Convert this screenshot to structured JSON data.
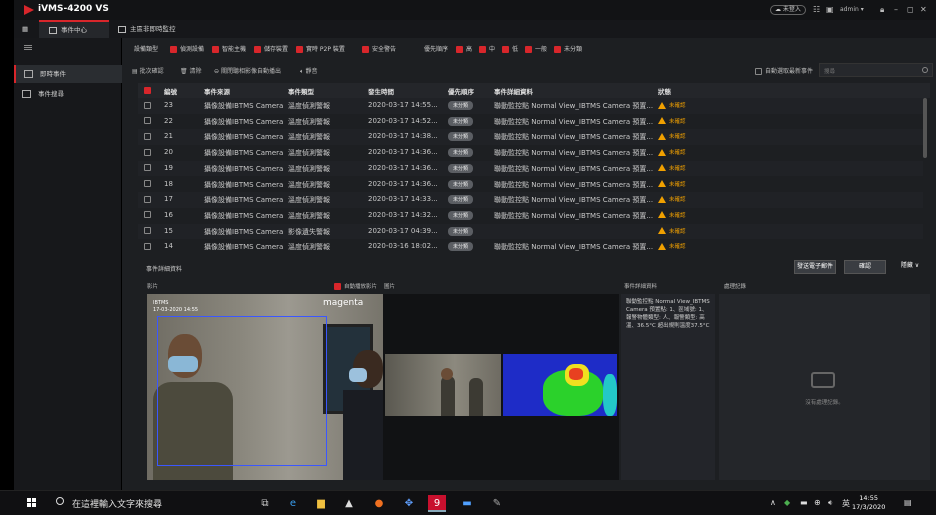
{
  "app": {
    "title": "iVMS-4200 VS",
    "login": "未登入",
    "user": "admin ▾"
  },
  "tabs": [
    "事件中心",
    "主區非即時監控"
  ],
  "sidebar": {
    "items": [
      "即時事件",
      "事件搜尋"
    ]
  },
  "filters": {
    "label_type": "設備類型",
    "types": [
      "偵測設備",
      "智能主機",
      "儲存裝置",
      "實時 P2P 裝置",
      "安全警告"
    ],
    "label_priority": "優先順序",
    "priorities": [
      "高",
      "中",
      "低",
      "一般",
      "未分類"
    ]
  },
  "toolbar": {
    "batch": "批次確認",
    "clear": "清除",
    "popup": "關閉聽相影像自動播出",
    "mute": "靜音",
    "auto_select": "自動選取最新事件",
    "search_placeholder": "搜尋"
  },
  "table": {
    "headers": [
      "編號",
      "事件來源",
      "事件類型",
      "發生時間",
      "優先順序",
      "事件詳細資料",
      "狀態"
    ],
    "rows": [
      {
        "no": "23",
        "source": "攝像設備IBTMS Camera ...",
        "type": "溫度偵測警報",
        "time": "2020-03-17 14:55...",
        "priority": "未分類",
        "detail": "聯動監控點 Normal View_IBTMS Camera 預置...",
        "status": "未確認"
      },
      {
        "no": "22",
        "source": "攝像設備IBTMS Camera ...",
        "type": "溫度偵測警報",
        "time": "2020-03-17 14:52...",
        "priority": "未分類",
        "detail": "聯動監控點 Normal View_IBTMS Camera 預置...",
        "status": "未確認"
      },
      {
        "no": "21",
        "source": "攝像設備IBTMS Camera ...",
        "type": "溫度偵測警報",
        "time": "2020-03-17 14:38...",
        "priority": "未分類",
        "detail": "聯動監控點 Normal View_IBTMS Camera 預置...",
        "status": "未確認"
      },
      {
        "no": "20",
        "source": "攝像設備IBTMS Camera ...",
        "type": "溫度偵測警報",
        "time": "2020-03-17 14:36...",
        "priority": "未分類",
        "detail": "聯動監控點 Normal View_IBTMS Camera 預置...",
        "status": "未確認"
      },
      {
        "no": "19",
        "source": "攝像設備IBTMS Camera ...",
        "type": "溫度偵測警報",
        "time": "2020-03-17 14:36...",
        "priority": "未分類",
        "detail": "聯動監控點 Normal View_IBTMS Camera 預置...",
        "status": "未確認"
      },
      {
        "no": "18",
        "source": "攝像設備IBTMS Camera ...",
        "type": "溫度偵測警報",
        "time": "2020-03-17 14:36...",
        "priority": "未分類",
        "detail": "聯動監控點 Normal View_IBTMS Camera 預置...",
        "status": "未確認"
      },
      {
        "no": "17",
        "source": "攝像設備IBTMS Camera ...",
        "type": "溫度偵測警報",
        "time": "2020-03-17 14:33...",
        "priority": "未分類",
        "detail": "聯動監控點 Normal View_IBTMS Camera 預置...",
        "status": "未確認"
      },
      {
        "no": "16",
        "source": "攝像設備IBTMS Camera ...",
        "type": "溫度偵測警報",
        "time": "2020-03-17 14:32...",
        "priority": "未分類",
        "detail": "聯動監控點 Normal View_IBTMS Camera 預置...",
        "status": "未確認"
      },
      {
        "no": "15",
        "source": "攝像設備IBTMS Camera",
        "type": "影像遺失警報",
        "time": "2020-03-17 04:39...",
        "priority": "未分類",
        "detail": "",
        "status": "未確認"
      },
      {
        "no": "14",
        "source": "攝像設備IBTMS Camera ...",
        "type": "溫度偵測警報",
        "time": "2020-03-16 18:02...",
        "priority": "未分類",
        "detail": "聯動監控點 Normal View_IBTMS Camera 預置...",
        "status": "未確認"
      }
    ]
  },
  "details": {
    "title": "事件詳細資料",
    "btn_email": "發送電子郵件",
    "btn_confirm": "確認",
    "btn_more": "隱藏 ∨",
    "label_video": "影片",
    "label_autoplay": "自動播放影片",
    "label_image": "圖片",
    "label_event_detail": "事件詳細資料",
    "label_record": "處理記錄",
    "video_overlay_line1": "IBTMS",
    "video_overlay_line2": "17-03-2020 14:55",
    "video_brand": "magenta",
    "event_text": "聯動監控點 Normal View_IBTMS Camera 預置點: 1、區域號: 1、報警物體類型: 人、報警類型: 高溫、36.5°C 超出規則溫度37.5°C",
    "record_empty": "沒有處理記錄。"
  },
  "taskbar": {
    "search_placeholder": "在這裡輸入文字來搜尋",
    "time": "14:55",
    "date": "17/3/2020",
    "lang": "英"
  }
}
